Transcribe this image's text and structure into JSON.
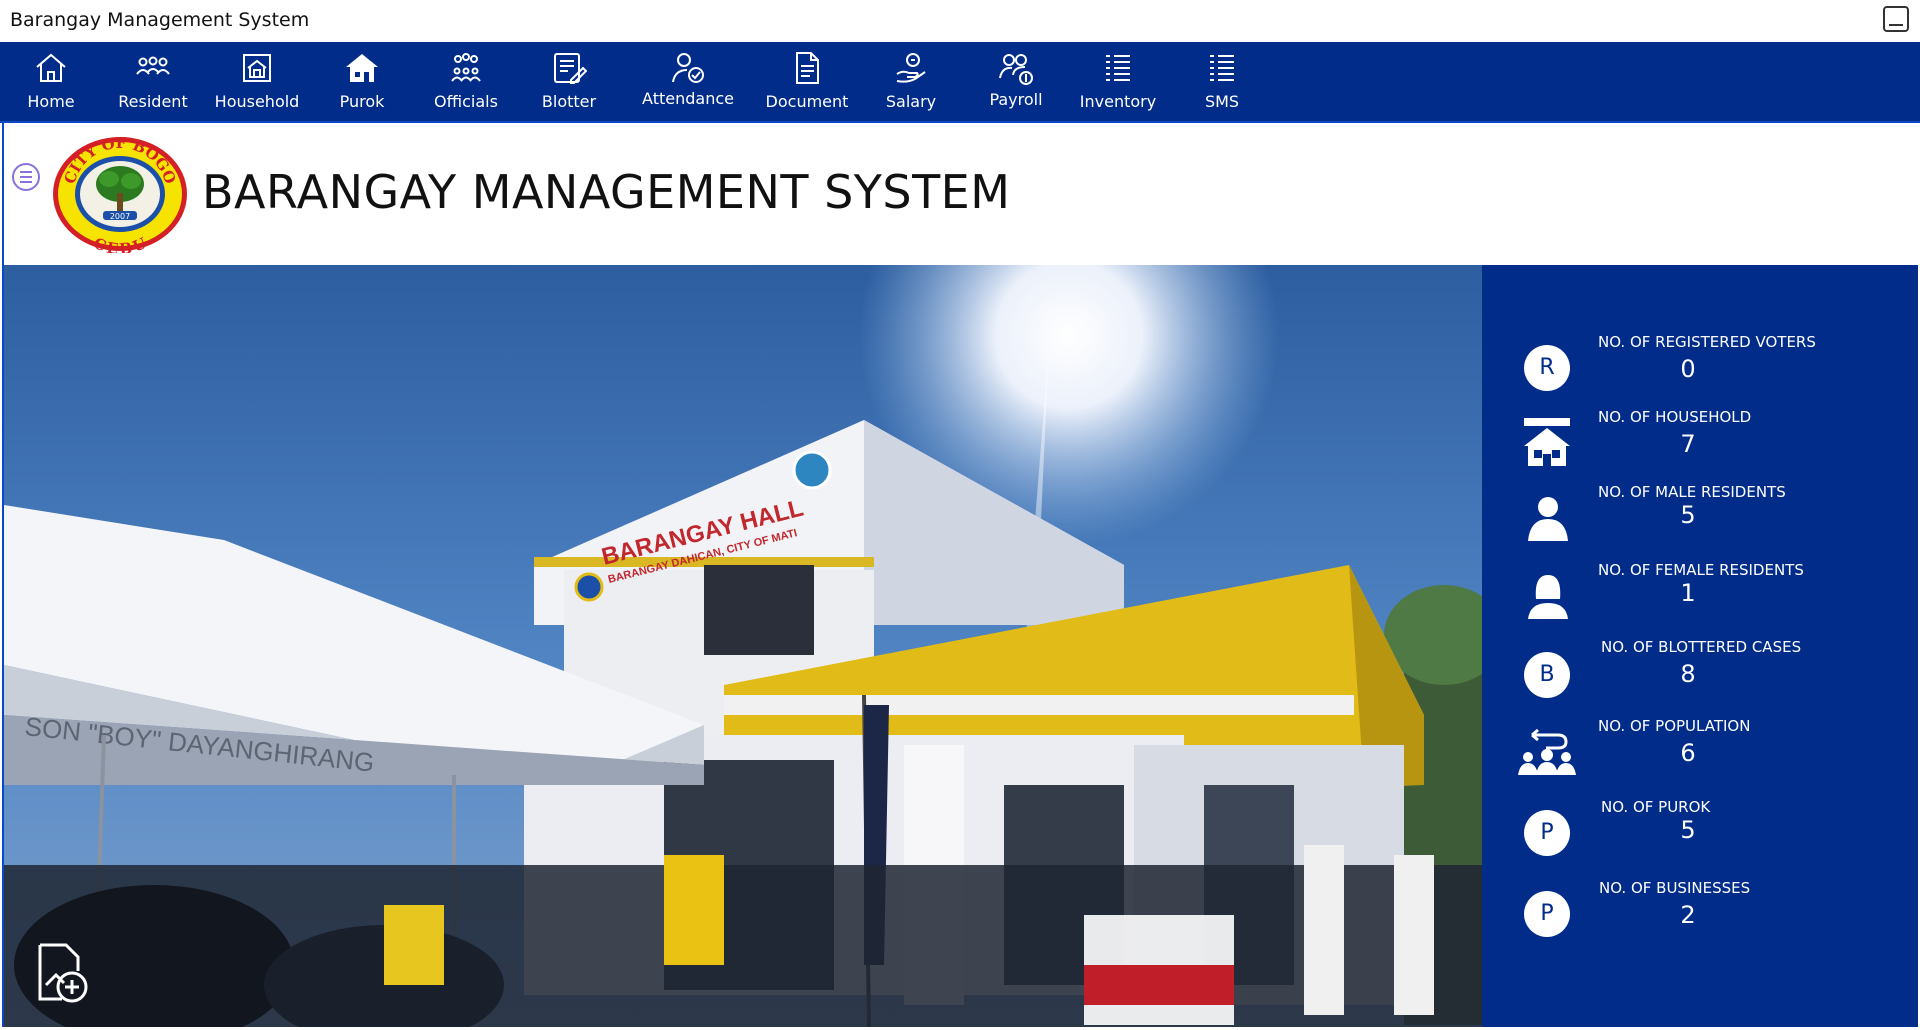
{
  "window": {
    "title": "Barangay Management System"
  },
  "nav": {
    "items": [
      {
        "label": "Home",
        "icon": "home-icon"
      },
      {
        "label": "Resident",
        "icon": "residents-icon"
      },
      {
        "label": "Household",
        "icon": "household-icon"
      },
      {
        "label": "Purok",
        "icon": "purok-house-icon"
      },
      {
        "label": "Officials",
        "icon": "officials-icon"
      },
      {
        "label": "Blotter",
        "icon": "blotter-icon"
      },
      {
        "label": "Attendance",
        "icon": "attendance-icon"
      },
      {
        "label": "Document",
        "icon": "document-icon"
      },
      {
        "label": "Salary",
        "icon": "salary-icon"
      },
      {
        "label": "Payroll",
        "icon": "payroll-icon"
      },
      {
        "label": "Inventory",
        "icon": "inventory-icon"
      },
      {
        "label": "SMS",
        "icon": "sms-icon"
      }
    ]
  },
  "header": {
    "title": "BARANGAY MANAGEMENT SYSTEM",
    "seal": {
      "top_text": "CITY OF BOGO",
      "bottom_text": "CEBU",
      "year": "2007"
    }
  },
  "hero": {
    "signage": {
      "line1": "BARANGAY HALL",
      "line2": "BARANGAY DAHICAN, CITY OF MATI"
    },
    "tent_text": "SON \"BOY\" DAYANGHIRANG"
  },
  "stats": [
    {
      "label": "NO. OF  REGISTERED VOTERS",
      "value": "0",
      "badge": "R"
    },
    {
      "label": "NO. OF HOUSEHOLD",
      "value": "7",
      "icon": "household-icon"
    },
    {
      "label": "NO. OF MALE RESIDENTS",
      "value": "5",
      "icon": "male-icon"
    },
    {
      "label": "NO. OF FEMALE RESIDENTS",
      "value": "1",
      "icon": "female-icon"
    },
    {
      "label": "NO. OF BLOTTERED CASES",
      "value": "8",
      "badge": "B"
    },
    {
      "label": "NO. OF POPULATION",
      "value": "6",
      "icon": "population-icon"
    },
    {
      "label": "NO. OF PUROK",
      "value": "5",
      "badge": "P"
    },
    {
      "label": "NO. OF BUSINESSES",
      "value": "2",
      "badge": "P"
    }
  ],
  "colors": {
    "nav_bg": "#012c8a",
    "panel_bg": "#012c8a",
    "accent": "#0a48c6"
  }
}
